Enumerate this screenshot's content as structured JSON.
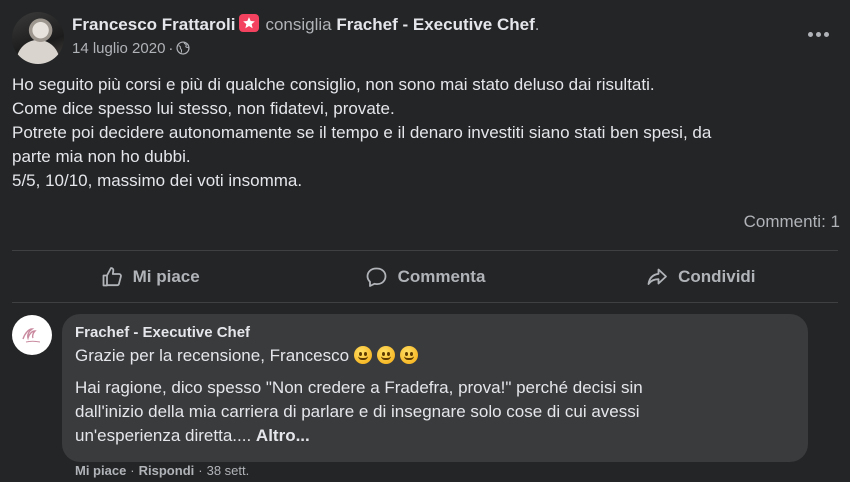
{
  "post": {
    "author": "Francesco Frattaroli",
    "action_text": "consiglia",
    "page_name": "Frachef - Executive Chef",
    "end_punct": ".",
    "date": "14 luglio 2020",
    "separator": "·",
    "body_lines": [
      "Ho seguito più corsi e più di qualche consiglio, non sono mai stato deluso dai risultati.",
      "Come dice spesso lui stesso, non fidatevi, provate.",
      "Potrete poi decidere autonomamente se il tempo e il denaro investiti siano stati ben spesi, da",
      "parte mia non ho dubbi.",
      "5/5, 10/10, massimo dei voti insomma."
    ],
    "comment_count": "Commenti: 1"
  },
  "actions": {
    "like": "Mi piace",
    "comment": "Commenta",
    "share": "Condividi"
  },
  "comment": {
    "author": "Frachef - Executive Chef",
    "line1": "Grazie per la recensione, Francesco",
    "lines": [
      "Hai ragione, dico spesso \"Non credere a Fradefra, prova!\" perché decisi sin",
      "dall'inizio della mia carriera di parlare e di insegnare solo cose di cui avessi",
      "un'esperienza diretta...."
    ],
    "more_label": "Altro...",
    "like": "Mi piace",
    "reply": "Rispondi",
    "dot": "·",
    "age": "38 sett."
  },
  "icons": {
    "recommend_badge": "star-badge-icon",
    "privacy": "globe-icon",
    "more": "more-options-icon",
    "like": "thumbs-up-icon",
    "comment": "speech-bubble-icon",
    "share": "share-arrow-icon",
    "emoji": "smiling-face-icon"
  },
  "colors": {
    "background": "#242526",
    "bubble": "#3a3b3c",
    "primary_text": "#e4e6eb",
    "secondary_text": "#b0b3b8",
    "badge": "#f3425f"
  }
}
